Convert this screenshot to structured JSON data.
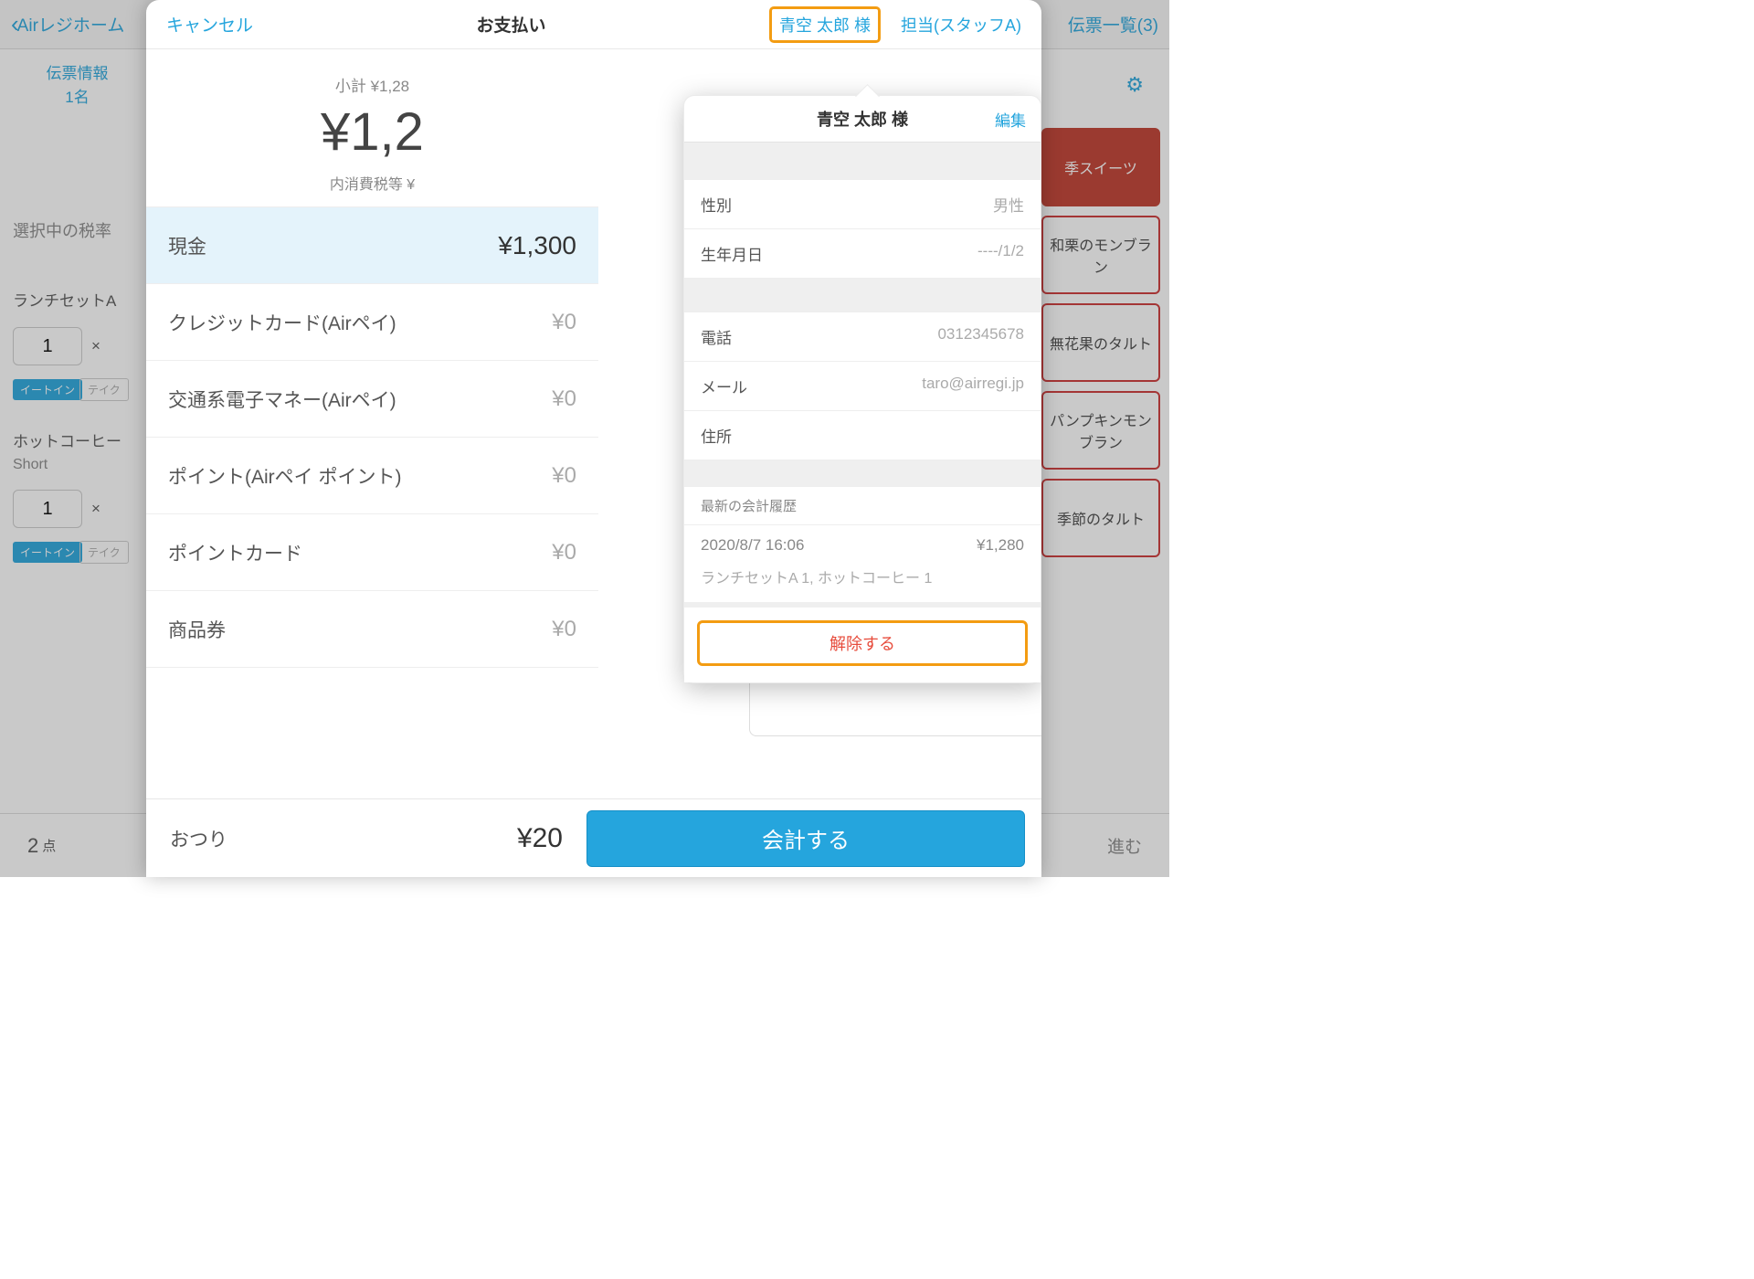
{
  "bg": {
    "back": "Airレジホーム",
    "slips": "伝票一覧(3)",
    "sidebar": {
      "slip_label": "伝票情報",
      "slip_people": "1名",
      "tax_label": "選択中の税率",
      "item1": "ランチセットA",
      "item2": "ホットコーヒー",
      "item2_sub": "Short",
      "qty": "1",
      "mult": "×",
      "eatin": "イートイン",
      "takeout": "テイク"
    },
    "products": [
      "季スイーツ",
      "和栗のモンブラン",
      "無花果のタルト",
      "パンプキンモンブラン",
      "季節のタルト"
    ],
    "footer": {
      "count": "2",
      "unit": "点",
      "proceed": "進む"
    }
  },
  "modal": {
    "cancel": "キャンセル",
    "title": "お支払い",
    "customer": "青空 太郎 様",
    "staff": "担当(スタッフA)",
    "subtotal_label": "小計",
    "subtotal": "¥1,28",
    "total": "¥1,2",
    "tax_label": "内消費税等",
    "tax_amount": "¥",
    "rows": [
      {
        "label": "現金",
        "amount": "¥1,300",
        "active": true
      },
      {
        "label": "クレジットカード(Airペイ)",
        "amount": "¥0"
      },
      {
        "label": "交通系電子マネー(Airペイ)",
        "amount": "¥0"
      },
      {
        "label": "ポイント(Airペイ ポイント)",
        "amount": "¥0"
      },
      {
        "label": "ポイントカード",
        "amount": "¥0"
      },
      {
        "label": "商品券",
        "amount": "¥0"
      }
    ],
    "change_label": "おつり",
    "change_amount": "¥20",
    "checkout": "会計する"
  },
  "popover": {
    "name": "青空 太郎 様",
    "edit": "編集",
    "rows1": [
      {
        "label": "性別",
        "value": "男性"
      },
      {
        "label": "生年月日",
        "value": "----/1/2"
      }
    ],
    "rows2": [
      {
        "label": "電話",
        "value": "0312345678"
      },
      {
        "label": "メール",
        "value": "taro@airregi.jp"
      },
      {
        "label": "住所",
        "value": ""
      }
    ],
    "history_header": "最新の会計履歴",
    "history_date": "2020/8/7 16:06",
    "history_amount": "¥1,280",
    "history_items": "ランチセットA 1, ホットコーヒー 1",
    "unlink": "解除する"
  }
}
